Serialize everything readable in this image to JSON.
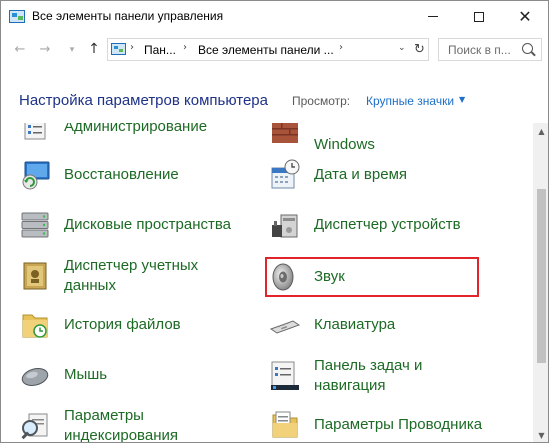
{
  "window": {
    "title": "Все элементы панели управления",
    "colors": {
      "link_green": "#1d6a25",
      "title_blue": "#1e3287",
      "accent_blue": "#1e6fc7",
      "highlight_red": "#e0242a"
    }
  },
  "address": {
    "crumbs": [
      "Пан...",
      "Все элементы панели ..."
    ],
    "search_placeholder": "Поиск в п..."
  },
  "header": {
    "title": "Настройка параметров компьютера",
    "view_label": "Просмотр:",
    "view_value": "Крупные значки"
  },
  "items": {
    "admin": "Администрирование",
    "windows": "Windows",
    "recovery": "Восстановление",
    "datetime": "Дата и время",
    "storage": "Дисковые пространства",
    "devmgr": "Диспетчер устройств",
    "credmgr_1": "Диспетчер учетных",
    "credmgr_2": "данных",
    "sound": "Звук",
    "history": "История файлов",
    "keyboard": "Клавиатура",
    "mouse": "Мышь",
    "taskbar_1": "Панель задач и",
    "taskbar_2": "навигация",
    "indexing_1": "Параметры",
    "indexing_2": "индексирования",
    "explorer": "Параметры Проводника"
  }
}
